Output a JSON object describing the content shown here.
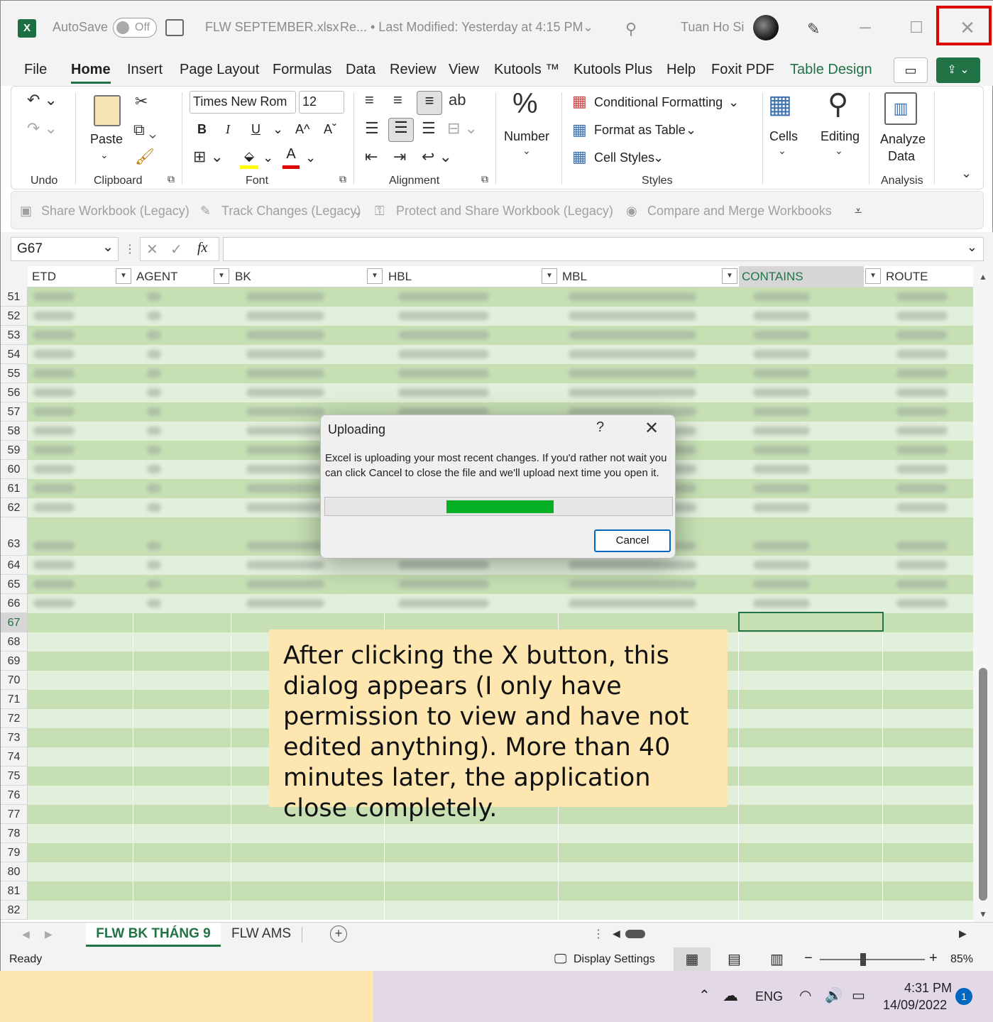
{
  "titlebar": {
    "app_icon": "excel-icon",
    "autosave_label": "AutoSave",
    "autosave_state": "Off",
    "filename": "FLW SEPTEMBER.xlsx",
    "separator": "-",
    "status_short": "Re...",
    "last_modified": "• Last Modified: Yesterday at 4:15 PM",
    "user_name": "Tuan Ho Si"
  },
  "menu": {
    "tabs": [
      "File",
      "Home",
      "Insert",
      "Page Layout",
      "Formulas",
      "Data",
      "Review",
      "View",
      "Kutools ™",
      "Kutools Plus",
      "Help",
      "Foxit PDF",
      "Table Design"
    ],
    "active": "Home",
    "contextual_color": "#217346"
  },
  "ribbon": {
    "groups": {
      "undo": "Undo",
      "clipboard": "Clipboard",
      "font": "Font",
      "alignment": "Alignment",
      "styles": "Styles",
      "analysis": "Analysis"
    },
    "paste": "Paste",
    "font_name": "Times New Rom",
    "font_size": "12",
    "bold": "B",
    "italic": "I",
    "underline": "U",
    "grow": "A^",
    "shrink": "Aˇ",
    "number": "Number",
    "number_glyph": "%",
    "conditional_formatting": "Conditional Formatting",
    "format_as_table": "Format as Table",
    "cell_styles": "Cell Styles",
    "cells": "Cells",
    "editing": "Editing",
    "analyze_data": "Analyze Data"
  },
  "sharebar": {
    "share_workbook": "Share Workbook (Legacy)",
    "track_changes": "Track Changes (Legacy)",
    "protect_share": "Protect and Share Workbook (Legacy)",
    "compare_merge": "Compare and Merge Workbooks"
  },
  "formula": {
    "name_box": "G67",
    "fx": "fx",
    "value": ""
  },
  "columns": [
    "ETD",
    "AGENT",
    "BK",
    "HBL",
    "MBL",
    "CONTAINS",
    "ROUTE"
  ],
  "row_numbers": [
    "51",
    "52",
    "53",
    "54",
    "55",
    "56",
    "57",
    "58",
    "59",
    "60",
    "61",
    "62",
    "63",
    "64",
    "65",
    "66",
    "67",
    "68",
    "69",
    "70",
    "71",
    "72",
    "73",
    "74",
    "75",
    "76",
    "77",
    "78",
    "79",
    "80",
    "81",
    "82"
  ],
  "colors": {
    "band_dark": "#c6e0b4",
    "band_light": "#e2efda",
    "accent": "#217346"
  },
  "dialog": {
    "title": "Uploading",
    "help": "?",
    "close": "✕",
    "message": "Excel is uploading your most recent changes. If you'd rather not wait you can click Cancel to close the file and we'll upload next time you open it.",
    "progress": 0.31,
    "cancel": "Cancel"
  },
  "note": "After clicking the X button, this dialog appears (I only have permission to view and have not edited anything). More than 40 minutes later, the application close completely.",
  "sheets": {
    "tabs": [
      "FLW BK THÁNG 9",
      "FLW AMS"
    ],
    "active": "FLW BK THÁNG 9"
  },
  "status": {
    "ready": "Ready",
    "display_settings": "Display Settings",
    "zoom": "85%"
  },
  "taskbar": {
    "language": "ENG",
    "time": "4:31 PM",
    "date": "14/09/2022",
    "notifications": "1"
  }
}
